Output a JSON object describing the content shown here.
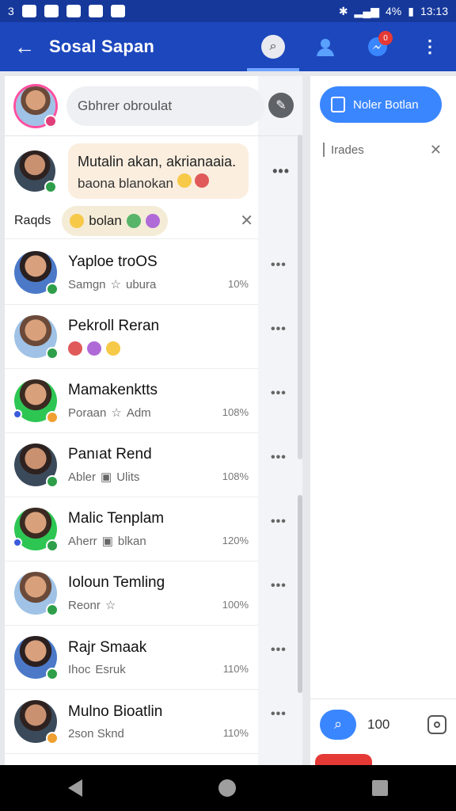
{
  "status_bar": {
    "left_text": "3",
    "battery": "4%",
    "time": "13:13"
  },
  "app_bar": {
    "title": "Sosal Sapan",
    "notification_count": "0"
  },
  "composer": {
    "placeholder": "Gbhrer obroulat"
  },
  "featured_message": {
    "line1": "Mutalin akan, akrianaaia.",
    "line2": "baona blanokan"
  },
  "reaction_bar": {
    "label": "Raqds",
    "chip_text": "bolan"
  },
  "conversations": [
    {
      "name": "Yaploe troOS",
      "sub": "Samgn",
      "sub2": "ubura",
      "pct": "10%"
    },
    {
      "name": "Pekroll Reran",
      "sub": "",
      "sub2": "",
      "pct": ""
    },
    {
      "name": "Mamakenktts",
      "sub": "Poraan",
      "sub2": "Adm",
      "pct": "108%"
    },
    {
      "name": "Panıat Rend",
      "sub": "Abler",
      "sub2": "Ulits",
      "pct": "108%"
    },
    {
      "name": "Malic Tenplam",
      "sub": "Aherr",
      "sub2": "blkan",
      "pct": "120%"
    },
    {
      "name": "Ioloun Temling",
      "sub": "Reonr",
      "sub2": "",
      "pct": "100%"
    },
    {
      "name": "Rajr Smaak",
      "sub": "Ihoc",
      "sub2": "Esruk",
      "pct": "110%"
    },
    {
      "name": "Mulno Bioatlin",
      "sub": "2son Sknd",
      "sub2": "",
      "pct": "110%"
    }
  ],
  "right_panel": {
    "new_button": "Noler Botlan",
    "field_text": "Irades",
    "zoom": "100"
  },
  "colors": {
    "app_bar": "#1c47bd",
    "status_bar": "#16389b",
    "accent": "#3a86ff"
  }
}
